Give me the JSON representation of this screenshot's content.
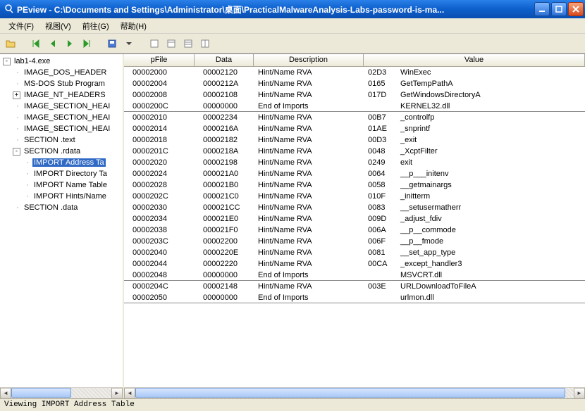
{
  "window": {
    "title": "PEview - C:\\Documents and Settings\\Administrator\\桌面\\PracticalMalwareAnalysis-Labs-password-is-ma..."
  },
  "menu": {
    "file": "文件(F)",
    "view": "视图(V)",
    "goto": "前往(G)",
    "help": "帮助(H)"
  },
  "toolbar_icons": {
    "open": "open-icon",
    "first": "first-icon",
    "prev": "prev-icon",
    "next": "next-icon",
    "last": "last-icon",
    "save": "save-icon",
    "item1": "box-icon",
    "item2": "box-icon",
    "item3": "box-icon",
    "item4": "box-icon"
  },
  "tree": [
    {
      "level": 0,
      "exp": "-",
      "label": "lab1-4.exe",
      "selected": false
    },
    {
      "level": 1,
      "exp": "",
      "label": "IMAGE_DOS_HEADER",
      "selected": false
    },
    {
      "level": 1,
      "exp": "",
      "label": "MS-DOS Stub Program",
      "selected": false
    },
    {
      "level": 1,
      "exp": "+",
      "label": "IMAGE_NT_HEADERS",
      "selected": false
    },
    {
      "level": 1,
      "exp": "",
      "label": "IMAGE_SECTION_HEADER",
      "selected": false,
      "clip": "IMAGE_SECTION_HEAI"
    },
    {
      "level": 1,
      "exp": "",
      "label": "IMAGE_SECTION_HEADER",
      "selected": false,
      "clip": "IMAGE_SECTION_HEAI"
    },
    {
      "level": 1,
      "exp": "",
      "label": "IMAGE_SECTION_HEADER",
      "selected": false,
      "clip": "IMAGE_SECTION_HEAI"
    },
    {
      "level": 1,
      "exp": "",
      "label": "SECTION .text",
      "selected": false
    },
    {
      "level": 1,
      "exp": "-",
      "label": "SECTION .rdata",
      "selected": false
    },
    {
      "level": 2,
      "exp": "",
      "label": "IMPORT Address Table",
      "selected": true,
      "clip": "IMPORT Address Ta"
    },
    {
      "level": 2,
      "exp": "",
      "label": "IMPORT Directory Table",
      "selected": false,
      "clip": "IMPORT Directory Ta"
    },
    {
      "level": 2,
      "exp": "",
      "label": "IMPORT Name Table",
      "selected": false
    },
    {
      "level": 2,
      "exp": "",
      "label": "IMPORT Hints/Names",
      "selected": false,
      "clip": "IMPORT Hints/Name"
    },
    {
      "level": 1,
      "exp": "",
      "label": "SECTION .data",
      "selected": false
    }
  ],
  "table": {
    "headers": {
      "pfile": "pFile",
      "data": "Data",
      "desc": "Description",
      "value": "Value"
    },
    "rows": [
      {
        "pfile": "00002000",
        "data": "00002120",
        "desc": "Hint/Name RVA",
        "hint": "02D3",
        "name": "WinExec"
      },
      {
        "pfile": "00002004",
        "data": "0000212A",
        "desc": "Hint/Name RVA",
        "hint": "0165",
        "name": "GetTempPathA"
      },
      {
        "pfile": "00002008",
        "data": "00002108",
        "desc": "Hint/Name RVA",
        "hint": "017D",
        "name": "GetWindowsDirectoryA"
      },
      {
        "pfile": "0000200C",
        "data": "00000000",
        "desc": "End of Imports",
        "hint": "",
        "name": "KERNEL32.dll",
        "sep": true
      },
      {
        "pfile": "00002010",
        "data": "00002234",
        "desc": "Hint/Name RVA",
        "hint": "00B7",
        "name": "_controlfp"
      },
      {
        "pfile": "00002014",
        "data": "0000216A",
        "desc": "Hint/Name RVA",
        "hint": "01AE",
        "name": "_snprintf"
      },
      {
        "pfile": "00002018",
        "data": "00002182",
        "desc": "Hint/Name RVA",
        "hint": "00D3",
        "name": "_exit"
      },
      {
        "pfile": "0000201C",
        "data": "0000218A",
        "desc": "Hint/Name RVA",
        "hint": "0048",
        "name": "_XcptFilter"
      },
      {
        "pfile": "00002020",
        "data": "00002198",
        "desc": "Hint/Name RVA",
        "hint": "0249",
        "name": "exit"
      },
      {
        "pfile": "00002024",
        "data": "000021A0",
        "desc": "Hint/Name RVA",
        "hint": "0064",
        "name": "__p___initenv"
      },
      {
        "pfile": "00002028",
        "data": "000021B0",
        "desc": "Hint/Name RVA",
        "hint": "0058",
        "name": "__getmainargs"
      },
      {
        "pfile": "0000202C",
        "data": "000021C0",
        "desc": "Hint/Name RVA",
        "hint": "010F",
        "name": "_initterm"
      },
      {
        "pfile": "00002030",
        "data": "000021CC",
        "desc": "Hint/Name RVA",
        "hint": "0083",
        "name": "__setusermatherr"
      },
      {
        "pfile": "00002034",
        "data": "000021E0",
        "desc": "Hint/Name RVA",
        "hint": "009D",
        "name": "_adjust_fdiv"
      },
      {
        "pfile": "00002038",
        "data": "000021F0",
        "desc": "Hint/Name RVA",
        "hint": "006A",
        "name": "__p__commode"
      },
      {
        "pfile": "0000203C",
        "data": "00002200",
        "desc": "Hint/Name RVA",
        "hint": "006F",
        "name": "__p__fmode"
      },
      {
        "pfile": "00002040",
        "data": "0000220E",
        "desc": "Hint/Name RVA",
        "hint": "0081",
        "name": "__set_app_type"
      },
      {
        "pfile": "00002044",
        "data": "00002220",
        "desc": "Hint/Name RVA",
        "hint": "00CA",
        "name": "_except_handler3"
      },
      {
        "pfile": "00002048",
        "data": "00000000",
        "desc": "End of Imports",
        "hint": "",
        "name": "MSVCRT.dll",
        "sep": true
      },
      {
        "pfile": "0000204C",
        "data": "00002148",
        "desc": "Hint/Name RVA",
        "hint": "003E",
        "name": "URLDownloadToFileA"
      },
      {
        "pfile": "00002050",
        "data": "00000000",
        "desc": "End of Imports",
        "hint": "",
        "name": "urlmon.dll",
        "sep": true
      }
    ]
  },
  "scroll": {
    "tree_thumb_width": "60%",
    "table_thumb_width": "98%"
  },
  "status": "Viewing IMPORT Address Table"
}
